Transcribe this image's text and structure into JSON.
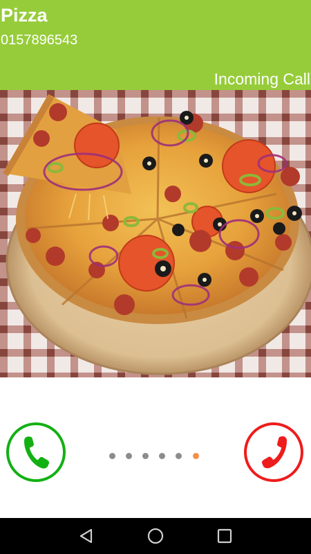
{
  "call": {
    "caller_name": "Pizza",
    "caller_number": "0157896543",
    "status": "Incoming Call"
  },
  "photo": {
    "subject": "pizza-photo"
  },
  "controls": {
    "answer_icon": "phone-icon",
    "decline_icon": "phone-hangup-icon",
    "page_count": 6,
    "active_page": 6
  },
  "navbar": {
    "icons": [
      "back-triangle-icon",
      "home-circle-icon",
      "recents-square-icon"
    ]
  },
  "colors": {
    "header_bg": "#96cc3a",
    "answer": "#13b013",
    "decline": "#ee1c1c",
    "dot_inactive": "#8c8c8c",
    "dot_active": "#f5904a",
    "navbar_bg": "#000000"
  }
}
